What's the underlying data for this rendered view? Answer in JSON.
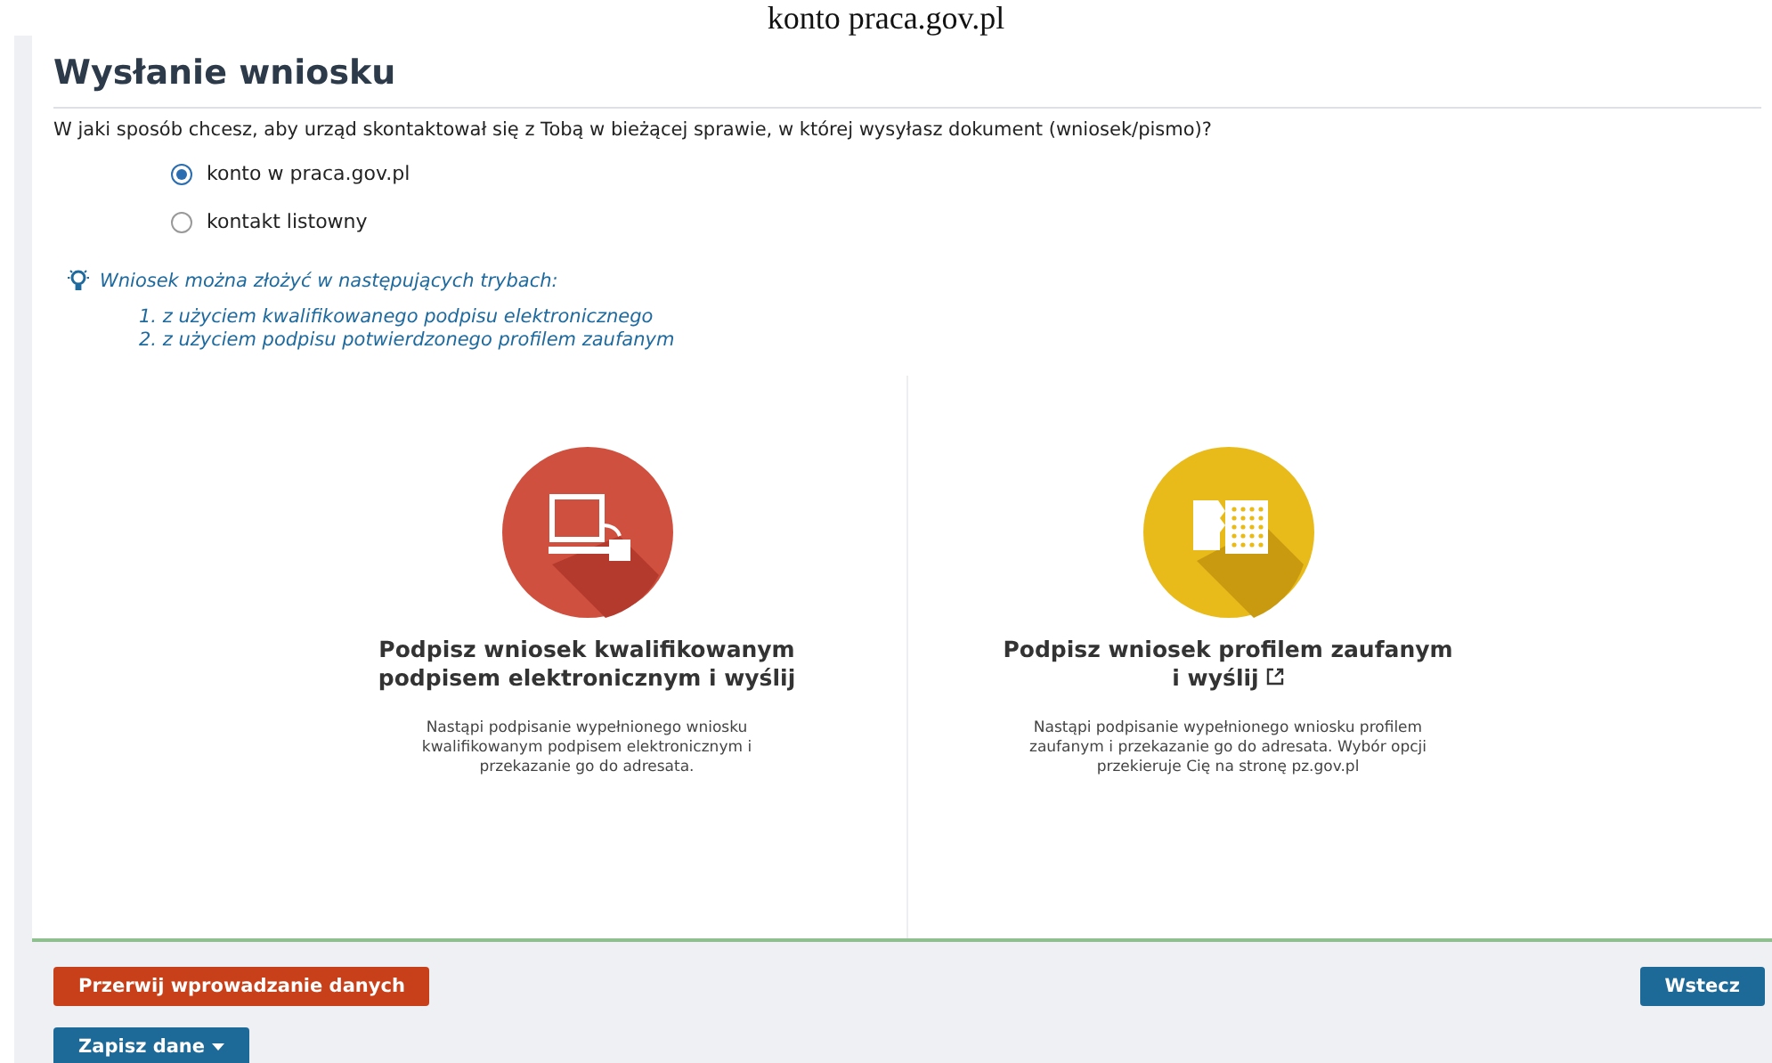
{
  "caption": "konto praca.gov.pl",
  "title": "Wysłanie wniosku",
  "question": "W jaki sposób chcesz, aby urząd skontaktował się z Tobą w bieżącej sprawie, w której wysyłasz dokument (wniosek/pismo)?",
  "contact_options": [
    {
      "label": "konto w praca.gov.pl",
      "selected": true
    },
    {
      "label": "kontakt listowny",
      "selected": false
    }
  ],
  "hint": {
    "text": "Wniosek można złożyć w następujących trybach:",
    "items": [
      "1. z użyciem kwalifikowanego podpisu elektronicznego",
      "2. z użyciem podpisu potwierdzonego profilem zaufanym"
    ]
  },
  "sign_options": [
    {
      "kind": "qualified",
      "title": "Podpisz wniosek kwalifikowanym podpisem elektronicznym i wyślij",
      "external": false,
      "description": "Nastąpi podpisanie wypełnionego wniosku kwalifikowanym podpisem elektronicznym i przekazanie go do adresata."
    },
    {
      "kind": "trusted",
      "title": "Podpisz wniosek profilem zaufanym i wyślij",
      "external": true,
      "description": "Nastąpi podpisanie wypełnionego wniosku profilem zaufanym i przekazanie go do adresata. Wybór opcji przekieruje Cię na stronę pz.gov.pl"
    }
  ],
  "footer": {
    "cancel": "Przerwij wprowadzanie danych",
    "back": "Wstecz",
    "save": "Zapisz dane"
  }
}
